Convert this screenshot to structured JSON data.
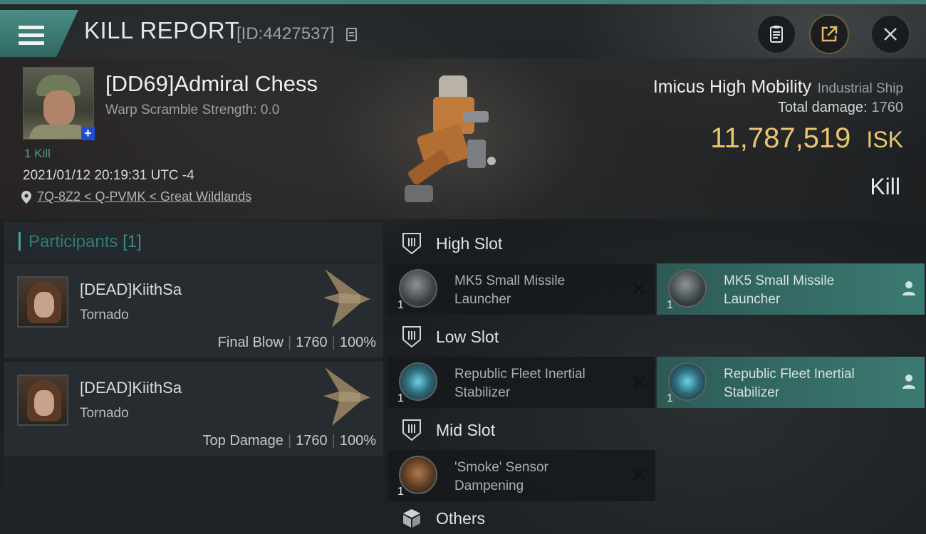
{
  "header": {
    "title": "KILL REPORT",
    "id_text": "[ID:4427537]"
  },
  "victim": {
    "name": "[DD69]Admiral Chess",
    "warp_scramble": "Warp Scramble Strength: 0.0",
    "kill_count": "1 Kill",
    "datetime": "2021/01/12 20:19:31 UTC -4",
    "location": "7Q-8Z2 < Q-PVMK < Great Wildlands",
    "ship_name": "Imicus High Mobility",
    "ship_class": "Industrial Ship",
    "total_damage_label": "Total damage:",
    "total_damage_value": "1760",
    "isk_value": "11,787,519",
    "isk_unit": "ISK",
    "result": "Kill"
  },
  "participants": {
    "title": "Participants",
    "count": "[1]",
    "rows": [
      {
        "name": "[DEAD]KiithSa",
        "ship": "Tornado",
        "role": "Final Blow",
        "damage": "1760",
        "percent": "100%"
      },
      {
        "name": "[DEAD]KiithSa",
        "ship": "Tornado",
        "role": "Top Damage",
        "damage": "1760",
        "percent": "100%"
      }
    ]
  },
  "slots": {
    "high": {
      "label": "High Slot",
      "destroyed": {
        "name": "MK5 Small Missile Launcher",
        "qty": "1"
      },
      "dropped": {
        "name": "MK5 Small Missile Launcher",
        "qty": "1"
      }
    },
    "low": {
      "label": "Low Slot",
      "destroyed": {
        "name": "Republic Fleet Inertial Stabilizer",
        "qty": "1"
      },
      "dropped": {
        "name": "Republic Fleet Inertial Stabilizer",
        "qty": "1"
      }
    },
    "mid": {
      "label": "Mid Slot",
      "destroyed": {
        "name": "'Smoke' Sensor Dampening",
        "qty": "1"
      }
    },
    "others": {
      "label": "Others"
    }
  },
  "colors": {
    "accent": "#3f7f78",
    "isk": "#e9c56e",
    "fitted": "#3b7a72"
  },
  "icons": [
    "menu-icon",
    "copy-icon",
    "clipboard-icon",
    "share-icon",
    "close-icon",
    "location-pin-icon",
    "slot-icon",
    "cube-icon",
    "x-icon",
    "person-icon"
  ]
}
